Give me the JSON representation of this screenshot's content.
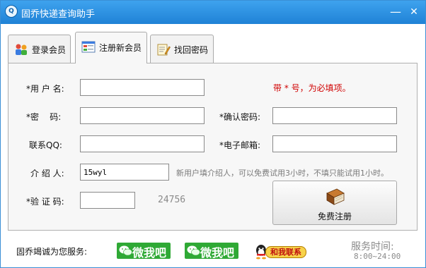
{
  "window": {
    "title": "固乔快递查询助手",
    "min_symbol": "—",
    "close_symbol": "✕"
  },
  "tabs": [
    {
      "label": "登录会员",
      "icon": "members-icon",
      "active": false
    },
    {
      "label": "注册新会员",
      "icon": "register-form-icon",
      "active": true
    },
    {
      "label": "找回密码",
      "icon": "notepad-pencil-icon",
      "active": false
    }
  ],
  "form": {
    "username_label": "*用 户 名:",
    "username_value": "",
    "required_note": "带 * 号，为必填项。",
    "password_label": "*密    码:",
    "password_value": "",
    "confirm_label": "*确认密码:",
    "confirm_value": "",
    "qq_label": "联系QQ:",
    "qq_value": "",
    "email_label": "*电子邮箱:",
    "email_value": "",
    "referrer_label": "介 绍 人:",
    "referrer_value": "15wyl",
    "referrer_note": "新用户填介绍人，可以免费试用3小时，不填只能试用1小时。",
    "captcha_label": "*验 证 码:",
    "captcha_value": "",
    "captcha_code": "24756",
    "submit_label": "免费注册"
  },
  "footer": {
    "service_label": "固乔竭诚为您服务:",
    "wechat1_label": "微我吧",
    "wechat2_label": "微我吧",
    "qq_label": "和我联系",
    "service_time_title": "服务时间:",
    "service_time_value": "8:00~24:00"
  },
  "colors": {
    "titlebar": "#1f82d6",
    "required_note": "#d00000",
    "wechat": "#2fa935"
  }
}
